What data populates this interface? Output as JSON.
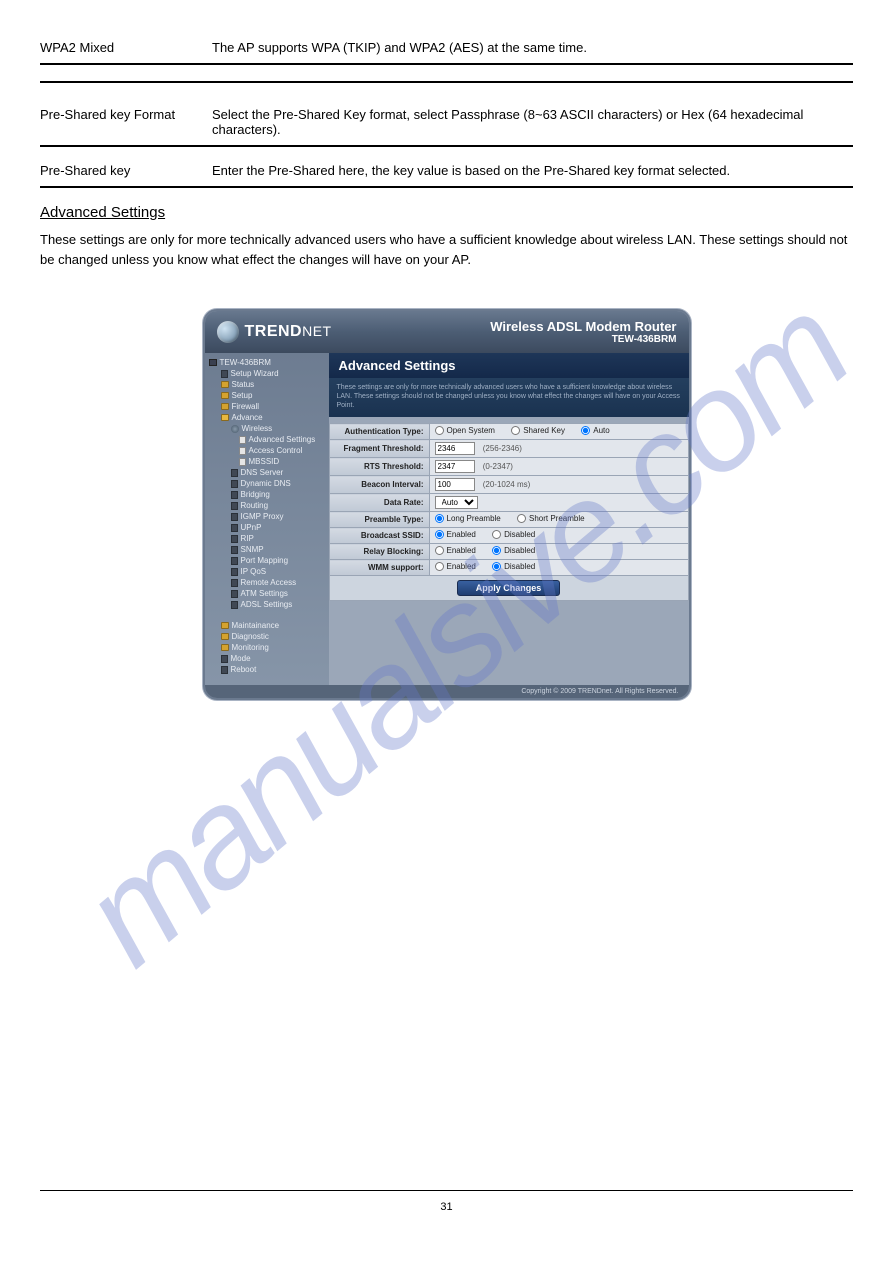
{
  "watermark": "manualsive.com",
  "doc": {
    "row1_label": "WPA2 Mixed",
    "row1_desc": "The AP supports WPA (TKIP) and WPA2 (AES) at the same time.",
    "row2_label": "Pre-Shared key Format",
    "row2_desc": "Select the Pre-Shared Key format, select Passphrase (8~63 ASCII characters) or Hex (64 hexadecimal characters).",
    "row3_label": "Pre-Shared key",
    "row3_desc": "Enter the Pre-Shared here, the key value is based on the Pre-Shared key format selected.",
    "heading": "Advanced Settings",
    "intro": "These settings are only for more technically advanced users who have a sufficient knowledge about wireless LAN. These settings should not be changed unless you know what effect the changes will have on your AP."
  },
  "router": {
    "brand": "TRENDNET",
    "title_main": "Wireless ADSL Modem Router",
    "title_sub": "TEW-436BRM",
    "footer": "Copyright © 2009 TRENDnet. All Rights Reserved."
  },
  "nav": {
    "root": "TEW-436BRM",
    "items1": [
      "Setup Wizard",
      "Status",
      "Setup",
      "Firewall",
      "Advance"
    ],
    "wireless": "Wireless",
    "wireless_sub": [
      "Advanced Settings",
      "Access Control",
      "MBSSID"
    ],
    "advance_rest": [
      "DNS Server",
      "Dynamic DNS",
      "Bridging",
      "Routing",
      "IGMP Proxy",
      "UPnP",
      "RIP",
      "SNMP",
      "Port Mapping",
      "IP QoS",
      "Remote Access",
      "ATM Settings",
      "ADSL Settings"
    ],
    "group2": [
      "Maintainance",
      "Diagnostic",
      "Monitoring",
      "Mode",
      "Reboot"
    ]
  },
  "panel": {
    "title": "Advanced Settings",
    "warning": "These settings are only for more technically advanced users who have a sufficient knowledge about wireless LAN. These settings should not be changed unless you know what effect the changes will have on your Access Point.",
    "auth": {
      "label": "Authentication Type:",
      "opt1": "Open System",
      "opt2": "Shared Key",
      "opt3": "Auto",
      "selected": "Auto"
    },
    "frag": {
      "label": "Fragment Threshold:",
      "value": "2346",
      "range": "(256-2346)"
    },
    "rts": {
      "label": "RTS Threshold:",
      "value": "2347",
      "range": "(0-2347)"
    },
    "beacon": {
      "label": "Beacon Interval:",
      "value": "100",
      "range": "(20-1024 ms)"
    },
    "datarate": {
      "label": "Data Rate:",
      "value": "Auto"
    },
    "preamble": {
      "label": "Preamble Type:",
      "opt1": "Long Preamble",
      "opt2": "Short Preamble",
      "selected": "Long Preamble"
    },
    "bssid": {
      "label": "Broadcast SSID:",
      "opt1": "Enabled",
      "opt2": "Disabled",
      "selected": "Enabled"
    },
    "relay": {
      "label": "Relay Blocking:",
      "opt1": "Enabled",
      "opt2": "Disabled",
      "selected": "Disabled"
    },
    "wmm": {
      "label": "WMM support:",
      "opt1": "Enabled",
      "opt2": "Disabled",
      "selected": "Disabled"
    },
    "apply": "Apply Changes"
  },
  "page_number": "31"
}
